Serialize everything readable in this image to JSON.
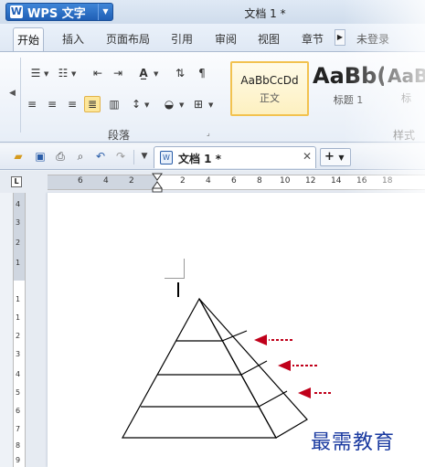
{
  "app": {
    "name": "WPS 文字",
    "doc_title": "文档 1 *"
  },
  "tabs": [
    "开始",
    "插入",
    "页面布局",
    "引用",
    "审阅",
    "视图",
    "章节"
  ],
  "account": "未登录",
  "ribbon": {
    "paragraph_group_label": "段落",
    "styles_group_label": "样式",
    "styles": [
      {
        "sample": "AaBbCcDd",
        "name": "正文"
      },
      {
        "sample": "AaBb(",
        "name": "标题 1"
      },
      {
        "sample": "AaB",
        "name": "标"
      }
    ]
  },
  "doc_tab": {
    "name": "文档 1 *"
  },
  "ruler": {
    "horizontal": [
      "6",
      "4",
      "2",
      "2",
      "4",
      "6",
      "8",
      "10",
      "12",
      "14",
      "16",
      "18"
    ],
    "vertical": [
      "4",
      "3",
      "2",
      "1",
      "1",
      "1",
      "2",
      "3",
      "4",
      "5",
      "6",
      "7",
      "8",
      "9"
    ]
  },
  "watermark": "最需教育",
  "colors": {
    "accent": "#1f5fb5",
    "arrow": "#c0001a"
  },
  "icons": {
    "bullets": "bullet-list-icon",
    "numbering": "numbered-list-icon",
    "outdent": "decrease-indent-icon",
    "indent": "increase-indent-icon",
    "case": "change-case-icon",
    "sort": "sort-icon",
    "marks": "show-marks-icon",
    "align_left": "align-left-icon",
    "align_center": "align-center-icon",
    "align_right": "align-right-icon",
    "justify": "justify-icon",
    "distributed": "distributed-icon",
    "spacing": "line-spacing-icon",
    "shading": "shading-icon",
    "borders": "borders-icon"
  }
}
